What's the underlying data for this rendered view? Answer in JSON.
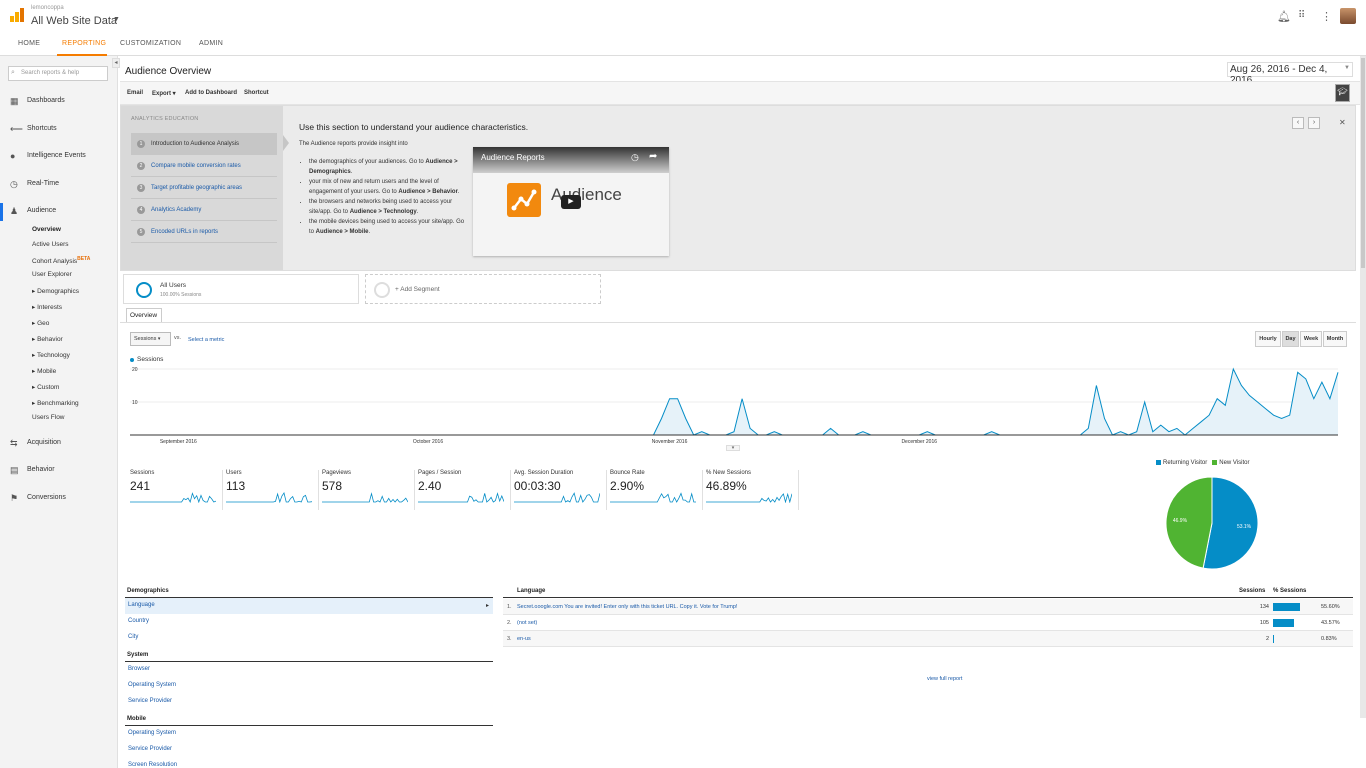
{
  "header": {
    "account_name": "lemoncoppa",
    "property_name": "All Web Site Data",
    "bell_icon": "bell-icon",
    "apps_icon": "apps-grid-icon",
    "more_icon": "more-vert-icon"
  },
  "nav": {
    "tabs": [
      "HOME",
      "REPORTING",
      "CUSTOMIZATION",
      "ADMIN"
    ],
    "active": "REPORTING"
  },
  "sidebar": {
    "search_placeholder": "Search reports & help",
    "items": [
      {
        "label": "Dashboards",
        "icon": "grid-icon"
      },
      {
        "label": "Shortcuts",
        "icon": "shortcut-arrow-icon"
      },
      {
        "label": "Intelligence Events",
        "icon": "bulb-icon"
      },
      {
        "label": "Real-Time",
        "icon": "clock-icon"
      },
      {
        "label": "Audience",
        "icon": "people-icon"
      }
    ],
    "audience_sub": [
      "Overview",
      "Active Users",
      "Cohort Analysis",
      "User Explorer",
      "▸ Demographics",
      "▸ Interests",
      "▸ Geo",
      "▸ Behavior",
      "▸ Technology",
      "▸ Mobile",
      "▸ Custom",
      "▸ Benchmarking",
      "Users Flow"
    ],
    "beta": "BETA",
    "bottom_items": [
      {
        "label": "Acquisition",
        "icon": "acquisition-icon"
      },
      {
        "label": "Behavior",
        "icon": "behavior-icon"
      },
      {
        "label": "Conversions",
        "icon": "flag-icon"
      }
    ]
  },
  "page": {
    "title": "Audience Overview",
    "date_range": "Aug 26, 2016 - Dec 4, 2016"
  },
  "toolbar": {
    "email": "Email",
    "export": "Export ▾",
    "add_dashboard": "Add to Dashboard",
    "shortcut": "Shortcut"
  },
  "education": {
    "heading": "ANALYTICS EDUCATION",
    "lessons": [
      {
        "num": "1",
        "label": "Introduction to Audience Analysis"
      },
      {
        "num": "2",
        "label": "Compare mobile conversion rates"
      },
      {
        "num": "3",
        "label": "Target profitable geographic areas"
      },
      {
        "num": "4",
        "label": "Analytics Academy"
      },
      {
        "num": "5",
        "label": "Encoded URLs in reports"
      }
    ],
    "title": "Use this section to understand your audience characteristics.",
    "intro": "The Audience reports provide insight into",
    "bullets": [
      {
        "text": "the demographics of your audiences. Go to ",
        "bold": "Audience > Demographics",
        "end": "."
      },
      {
        "text": "your mix of new and return users and the level of engagement of your users. Go to ",
        "bold": "Audience > Behavior",
        "end": "."
      },
      {
        "text": "the browsers and networks being used to access your site/app. Go to ",
        "bold": "Audience > Technology",
        "end": "."
      },
      {
        "text": "the mobile devices being used to access your site/app. Go to ",
        "bold": "Audience > Mobile",
        "end": "."
      }
    ],
    "video_title": "Audience Reports",
    "video_word": "Audience"
  },
  "segments": {
    "all_users": "All Users",
    "all_users_sub": "100.00% Sessions",
    "add_segment": "+ Add Segment"
  },
  "overview_tab": "Overview",
  "chart_controls": {
    "metric": "Sessions",
    "vs": "vs.",
    "select_metric": "Select a metric",
    "granularity": [
      "Hourly",
      "Day",
      "Week",
      "Month"
    ],
    "active_granularity": "Day"
  },
  "chart_data": [
    {
      "type": "area",
      "series": [
        {
          "name": "Sessions",
          "values": [
            0,
            0,
            0,
            0,
            0,
            0,
            0,
            0,
            0,
            0,
            0,
            0,
            0,
            0,
            0,
            0,
            0,
            0,
            0,
            0,
            0,
            0,
            0,
            0,
            0,
            0,
            0,
            0,
            0,
            0,
            0,
            0,
            0,
            0,
            0,
            0,
            0,
            0,
            0,
            0,
            0,
            0,
            0,
            0,
            0,
            0,
            0,
            0,
            0,
            0,
            0,
            0,
            0,
            0,
            0,
            0,
            0,
            0,
            0,
            0,
            0,
            0,
            0,
            0,
            0,
            0,
            5,
            11,
            11,
            5,
            0,
            1,
            0,
            0,
            0,
            1,
            11,
            2,
            0,
            0,
            1,
            0,
            0,
            0,
            0,
            0,
            0,
            2,
            0,
            0,
            0,
            1,
            0,
            0,
            0,
            0,
            0,
            0,
            0,
            1,
            0,
            0,
            0,
            0,
            0,
            0,
            0,
            1,
            0,
            0,
            0,
            0,
            0,
            0,
            0,
            0,
            0,
            0,
            0,
            2,
            15,
            5,
            0,
            1,
            0,
            1,
            10,
            1,
            3,
            1,
            2,
            0,
            2,
            4,
            6,
            11,
            9,
            20,
            15,
            12,
            10,
            8,
            6,
            5,
            6,
            19,
            17,
            11,
            16,
            11,
            19
          ]
        }
      ],
      "x_labels": [
        "September 2016",
        "October 2016",
        "November 2016",
        "December 2016"
      ],
      "yticks": [
        10,
        20
      ],
      "ylim": [
        0,
        20
      ]
    },
    {
      "type": "pie",
      "categories": [
        "Returning Visitor",
        "New Visitor"
      ],
      "values": [
        53.1,
        46.9
      ],
      "labels": [
        "53.1%",
        "46.9%"
      ],
      "colors": [
        "#058dc7",
        "#50b432"
      ]
    }
  ],
  "metrics": [
    {
      "label": "Sessions",
      "value": "241"
    },
    {
      "label": "Users",
      "value": "113"
    },
    {
      "label": "Pageviews",
      "value": "578"
    },
    {
      "label": "Pages / Session",
      "value": "2.40"
    },
    {
      "label": "Avg. Session Duration",
      "value": "00:03:30"
    },
    {
      "label": "Bounce Rate",
      "value": "2.90%"
    },
    {
      "label": "% New Sessions",
      "value": "46.89%"
    }
  ],
  "demographics": {
    "groups": [
      {
        "title": "Demographics",
        "links": [
          "Language",
          "Country",
          "City"
        ]
      },
      {
        "title": "System",
        "links": [
          "Browser",
          "Operating System",
          "Service Provider"
        ]
      },
      {
        "title": "Mobile",
        "links": [
          "Operating System",
          "Service Provider",
          "Screen Resolution"
        ]
      }
    ]
  },
  "language_table": {
    "headers": {
      "language": "Language",
      "sessions": "Sessions",
      "pct": "% Sessions"
    },
    "rows": [
      {
        "idx": "1.",
        "name": "Secret.ɢoogle.com You are invited! Enter only with this ticket URL. Copy it. Vote for Trump!",
        "sessions": "134",
        "pct": "55.60%",
        "share": 0.556
      },
      {
        "idx": "2.",
        "name": "(not set)",
        "sessions": "105",
        "pct": "43.57%",
        "share": 0.4357
      },
      {
        "idx": "3.",
        "name": "en-us",
        "sessions": "2",
        "pct": "0.83%",
        "share": 0.0083
      }
    ],
    "view_full": "view full report"
  }
}
